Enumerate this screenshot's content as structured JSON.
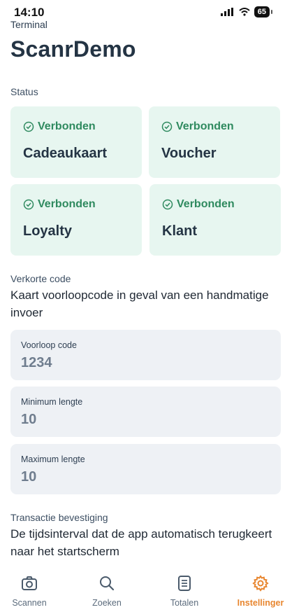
{
  "status_bar": {
    "time": "14:10",
    "battery": "65"
  },
  "header": {
    "terminal_label": "Terminal",
    "app_title": "ScanrDemo"
  },
  "status_section": {
    "label": "Status",
    "cards": [
      {
        "status": "Verbonden",
        "name": "Cadeaukaart"
      },
      {
        "status": "Verbonden",
        "name": "Voucher"
      },
      {
        "status": "Verbonden",
        "name": "Loyalty"
      },
      {
        "status": "Verbonden",
        "name": "Klant"
      }
    ]
  },
  "short_code_section": {
    "label": "Verkorte code",
    "description": "Kaart voorloopcode in geval van een handmatige invoer",
    "fields": [
      {
        "label": "Voorloop code",
        "value": "1234"
      },
      {
        "label": "Minimum lengte",
        "value": "10"
      },
      {
        "label": "Maximum lengte",
        "value": "10"
      }
    ]
  },
  "transaction_section": {
    "label": "Transactie bevestiging",
    "description": "De tijdsinterval dat de app automatisch terugkeert naar het startscherm"
  },
  "tabbar": {
    "items": [
      {
        "label": "Scannen",
        "icon": "camera-icon"
      },
      {
        "label": "Zoeken",
        "icon": "search-icon"
      },
      {
        "label": "Totalen",
        "icon": "document-icon"
      },
      {
        "label": "Instellinger",
        "icon": "gear-icon",
        "active": true
      }
    ]
  },
  "colors": {
    "accent": "#e8862f",
    "success": "#2f8a5f",
    "status_card_bg": "#e7f6f0",
    "field_bg": "#eef1f5"
  }
}
